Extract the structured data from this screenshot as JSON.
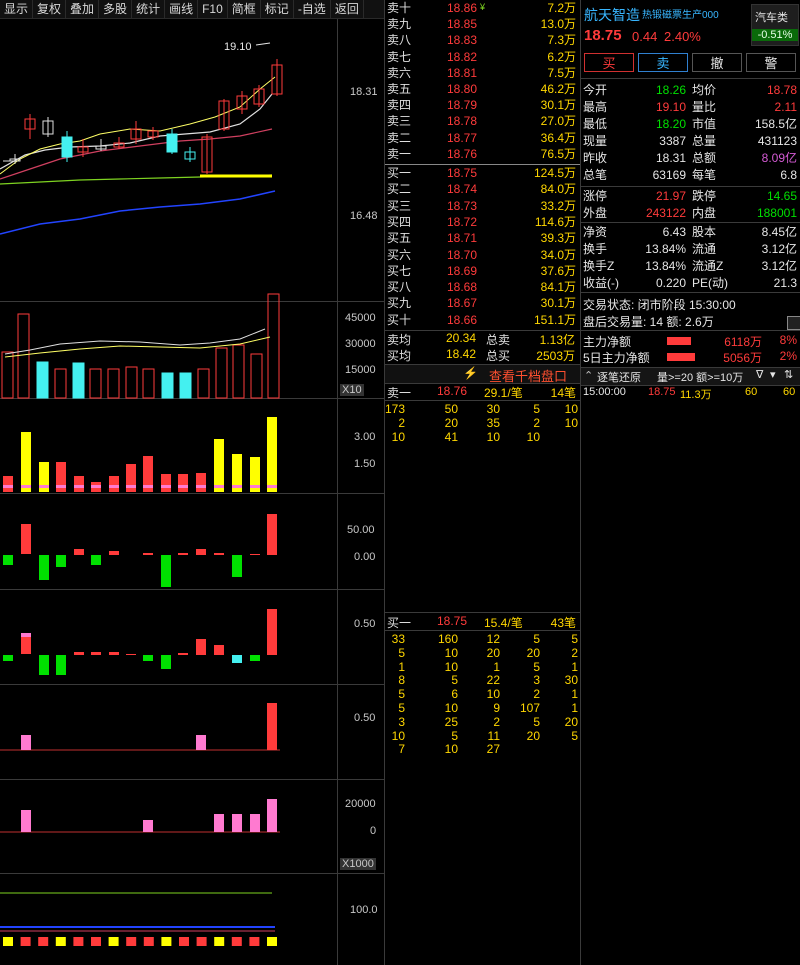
{
  "toolbar": [
    "显示",
    "复权",
    "叠加",
    "多股",
    "统计",
    "画线",
    "F10",
    "简框",
    "标记",
    "-自选",
    "返回"
  ],
  "kline": {
    "high_label": "19.10",
    "price_ticks": [
      "18.31",
      "16.48"
    ],
    "volume_ticks": [
      "45000",
      "30000",
      "15000"
    ],
    "volume_unit": "X10",
    "ind1_ticks": [
      "3.00",
      "1.50"
    ],
    "ind2_ticks": [
      "50.00",
      "0.00"
    ],
    "ind3_ticks": [
      "0.50"
    ],
    "ind4_ticks": [
      "0.50"
    ],
    "ind5_ticks": [
      "20000",
      "0"
    ],
    "ind5_unit": "X1000",
    "ind6_ticks": [
      "100.0"
    ]
  },
  "order_book": {
    "asks": [
      {
        "label": "卖十",
        "price": "18.86",
        "vol": "7.2万",
        "flag": "¥"
      },
      {
        "label": "卖九",
        "price": "18.85",
        "vol": "13.0万"
      },
      {
        "label": "卖八",
        "price": "18.83",
        "vol": "7.3万"
      },
      {
        "label": "卖七",
        "price": "18.82",
        "vol": "6.2万"
      },
      {
        "label": "卖六",
        "price": "18.81",
        "vol": "7.5万"
      },
      {
        "label": "卖五",
        "price": "18.80",
        "vol": "46.2万"
      },
      {
        "label": "卖四",
        "price": "18.79",
        "vol": "30.1万"
      },
      {
        "label": "卖三",
        "price": "18.78",
        "vol": "27.0万"
      },
      {
        "label": "卖二",
        "price": "18.77",
        "vol": "36.4万"
      },
      {
        "label": "卖一",
        "price": "18.76",
        "vol": "76.5万"
      }
    ],
    "bids": [
      {
        "label": "买一",
        "price": "18.75",
        "vol": "124.5万"
      },
      {
        "label": "买二",
        "price": "18.74",
        "vol": "84.0万"
      },
      {
        "label": "买三",
        "price": "18.73",
        "vol": "33.2万"
      },
      {
        "label": "买四",
        "price": "18.72",
        "vol": "114.6万"
      },
      {
        "label": "买五",
        "price": "18.71",
        "vol": "39.3万"
      },
      {
        "label": "买六",
        "price": "18.70",
        "vol": "34.0万"
      },
      {
        "label": "买七",
        "price": "18.69",
        "vol": "37.6万"
      },
      {
        "label": "买八",
        "price": "18.68",
        "vol": "84.1万"
      },
      {
        "label": "买九",
        "price": "18.67",
        "vol": "30.1万"
      },
      {
        "label": "买十",
        "price": "18.66",
        "vol": "151.1万"
      }
    ],
    "ask_avg_label": "卖均",
    "ask_avg": "20.34",
    "ask_total_label": "总卖",
    "ask_total": "1.13亿",
    "bid_avg_label": "买均",
    "bid_avg": "18.42",
    "bid_total_label": "总买",
    "bid_total": "2503万",
    "depth_link": "查看千档盘口",
    "sell1_label": "卖一",
    "sell1_price": "18.76",
    "sell1_avg": "29.1/笔",
    "sell1_count": "14笔",
    "sell_queue": [
      [
        "173",
        "50",
        "30",
        "5",
        "10"
      ],
      [
        "2",
        "20",
        "35",
        "2",
        "10"
      ],
      [
        "10",
        "41",
        "10",
        "10",
        ""
      ]
    ],
    "buy1_label": "买一",
    "buy1_price": "18.75",
    "buy1_avg": "15.4/笔",
    "buy1_count": "43笔",
    "buy_queue": [
      [
        "33",
        "160",
        "12",
        "5",
        "5"
      ],
      [
        "5",
        "10",
        "20",
        "20",
        "2"
      ],
      [
        "1",
        "10",
        "1",
        "5",
        "1"
      ],
      [
        "8",
        "5",
        "22",
        "3",
        "30"
      ],
      [
        "5",
        "6",
        "10",
        "2",
        "1"
      ],
      [
        "5",
        "10",
        "9",
        "107",
        "1"
      ],
      [
        "3",
        "25",
        "2",
        "5",
        "20"
      ],
      [
        "10",
        "5",
        "11",
        "20",
        "5"
      ],
      [
        "7",
        "10",
        "27",
        "",
        ""
      ]
    ]
  },
  "info": {
    "name": "航天智造",
    "tag": "热锻磁票生产000",
    "sector": "汽车类",
    "sector_change": "-0.51%",
    "price": "18.75",
    "change": "0.44",
    "change_pct": "2.40%",
    "buttons": [
      "买",
      "卖",
      "撤",
      "警"
    ],
    "rows": [
      [
        "今开",
        "18.26",
        "green",
        "均价",
        "18.78",
        "red"
      ],
      [
        "最高",
        "19.10",
        "red",
        "量比",
        "2.11",
        "red"
      ],
      [
        "最低",
        "18.20",
        "green",
        "市值",
        "158.5亿",
        "white"
      ],
      [
        "现量",
        "3387",
        "white",
        "总量",
        "431123",
        "white"
      ],
      [
        "昨收",
        "18.31",
        "white",
        "总额",
        "8.09亿",
        "purple"
      ],
      [
        "总笔",
        "63169",
        "white",
        "每笔",
        "6.8",
        "white"
      ],
      [
        "涨停",
        "21.97",
        "red",
        "跌停",
        "14.65",
        "green"
      ],
      [
        "外盘",
        "243122",
        "red",
        "内盘",
        "188001",
        "green"
      ],
      [
        "净资",
        "6.43",
        "white",
        "股本",
        "8.45亿",
        "white"
      ],
      [
        "换手",
        "13.84%",
        "white",
        "流通",
        "3.12亿",
        "white"
      ],
      [
        "换手Z",
        "13.84%",
        "white",
        "流通Z",
        "3.12亿",
        "white"
      ],
      [
        "收益(-)",
        "0.220",
        "white",
        "PE(动)",
        "21.3",
        "white"
      ]
    ],
    "trade_status": "交易状态: 闭市阶段 15:30:00",
    "after_hours": "盘后交易量: 14  额: 2.6万",
    "main_net_label": "主力净额",
    "main_net": "6118万",
    "main_net_pct": "8%",
    "main5_net_label": "5日主力净额",
    "main5_net": "5056万",
    "main5_net_pct": "2%",
    "tick_header": "逐笔还原",
    "tick_filter": "量>=20 额>=10万",
    "ticks": [
      {
        "time": "15:00:00",
        "price": "18.75",
        "amount": "11.3万",
        "a": "60",
        "b": "60"
      }
    ]
  },
  "colors": {
    "up": "#ff3b3b",
    "down": "#00e000",
    "cyan": "#44f0f0",
    "yellow": "#ffff00",
    "pink": "#ff7ad0"
  }
}
